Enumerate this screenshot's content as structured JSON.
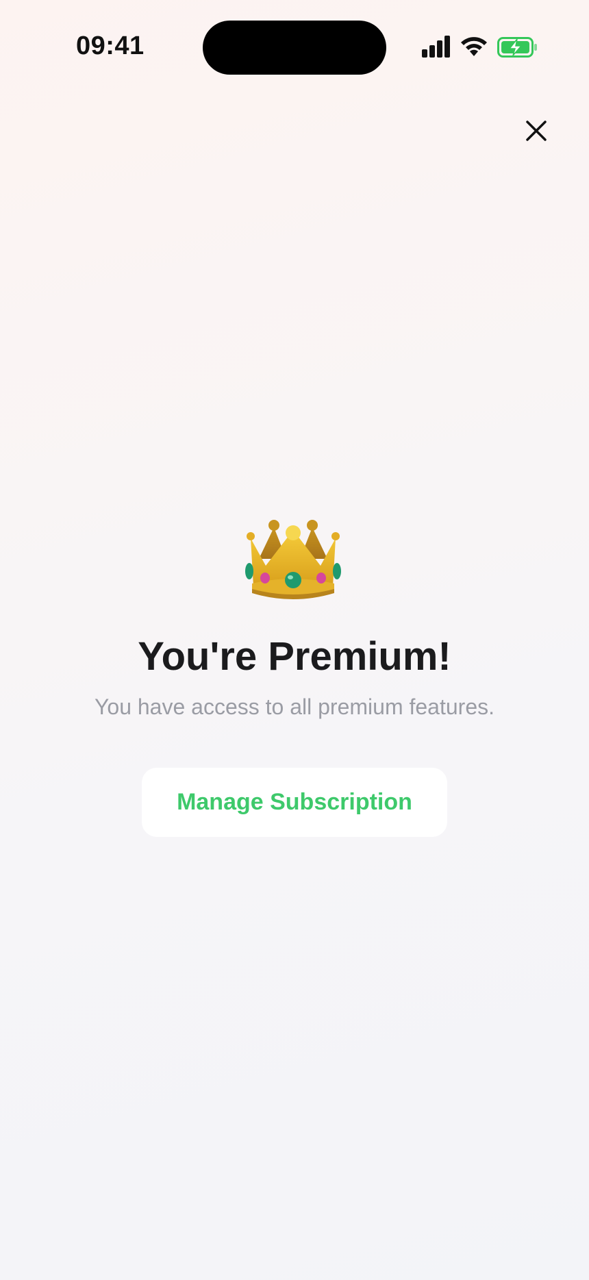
{
  "status_bar": {
    "time": "09:41",
    "signal_icon": "cellular-signal-icon",
    "wifi_icon": "wifi-icon",
    "battery_icon": "battery-charging-icon"
  },
  "header": {
    "close_icon": "close-icon"
  },
  "main": {
    "hero_icon": "crown-emoji-icon",
    "title": "You're Premium!",
    "subtitle": "You have access to all premium features.",
    "manage_button_label": "Manage Subscription"
  },
  "colors": {
    "accent": "#3ec96b",
    "title": "#1b1b1d",
    "subtitle": "#9a9ca4",
    "battery": "#34c759"
  }
}
